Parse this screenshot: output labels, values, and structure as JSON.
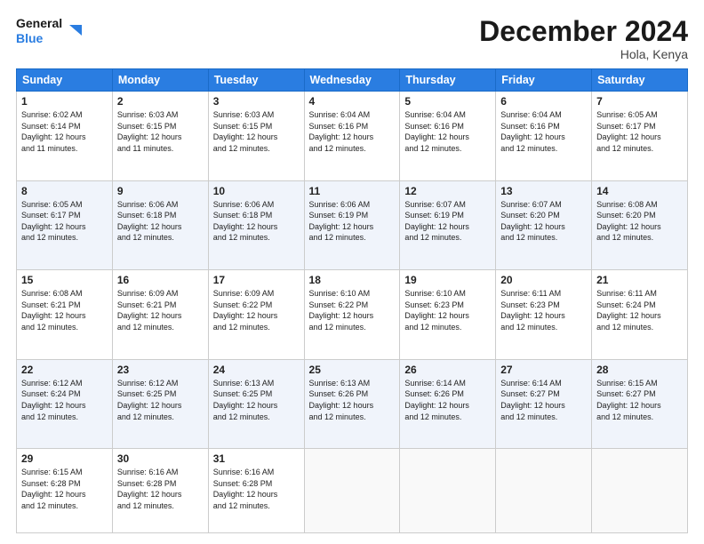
{
  "logo": {
    "line1": "General",
    "line2": "Blue"
  },
  "title": "December 2024",
  "location": "Hola, Kenya",
  "days_header": [
    "Sunday",
    "Monday",
    "Tuesday",
    "Wednesday",
    "Thursday",
    "Friday",
    "Saturday"
  ],
  "weeks": [
    [
      {
        "num": "1",
        "sunrise": "6:02 AM",
        "sunset": "6:14 PM",
        "daylight": "12 hours and 11 minutes."
      },
      {
        "num": "2",
        "sunrise": "6:03 AM",
        "sunset": "6:15 PM",
        "daylight": "12 hours and 11 minutes."
      },
      {
        "num": "3",
        "sunrise": "6:03 AM",
        "sunset": "6:15 PM",
        "daylight": "12 hours and 12 minutes."
      },
      {
        "num": "4",
        "sunrise": "6:04 AM",
        "sunset": "6:16 PM",
        "daylight": "12 hours and 12 minutes."
      },
      {
        "num": "5",
        "sunrise": "6:04 AM",
        "sunset": "6:16 PM",
        "daylight": "12 hours and 12 minutes."
      },
      {
        "num": "6",
        "sunrise": "6:04 AM",
        "sunset": "6:16 PM",
        "daylight": "12 hours and 12 minutes."
      },
      {
        "num": "7",
        "sunrise": "6:05 AM",
        "sunset": "6:17 PM",
        "daylight": "12 hours and 12 minutes."
      }
    ],
    [
      {
        "num": "8",
        "sunrise": "6:05 AM",
        "sunset": "6:17 PM",
        "daylight": "12 hours and 12 minutes."
      },
      {
        "num": "9",
        "sunrise": "6:06 AM",
        "sunset": "6:18 PM",
        "daylight": "12 hours and 12 minutes."
      },
      {
        "num": "10",
        "sunrise": "6:06 AM",
        "sunset": "6:18 PM",
        "daylight": "12 hours and 12 minutes."
      },
      {
        "num": "11",
        "sunrise": "6:06 AM",
        "sunset": "6:19 PM",
        "daylight": "12 hours and 12 minutes."
      },
      {
        "num": "12",
        "sunrise": "6:07 AM",
        "sunset": "6:19 PM",
        "daylight": "12 hours and 12 minutes."
      },
      {
        "num": "13",
        "sunrise": "6:07 AM",
        "sunset": "6:20 PM",
        "daylight": "12 hours and 12 minutes."
      },
      {
        "num": "14",
        "sunrise": "6:08 AM",
        "sunset": "6:20 PM",
        "daylight": "12 hours and 12 minutes."
      }
    ],
    [
      {
        "num": "15",
        "sunrise": "6:08 AM",
        "sunset": "6:21 PM",
        "daylight": "12 hours and 12 minutes."
      },
      {
        "num": "16",
        "sunrise": "6:09 AM",
        "sunset": "6:21 PM",
        "daylight": "12 hours and 12 minutes."
      },
      {
        "num": "17",
        "sunrise": "6:09 AM",
        "sunset": "6:22 PM",
        "daylight": "12 hours and 12 minutes."
      },
      {
        "num": "18",
        "sunrise": "6:10 AM",
        "sunset": "6:22 PM",
        "daylight": "12 hours and 12 minutes."
      },
      {
        "num": "19",
        "sunrise": "6:10 AM",
        "sunset": "6:23 PM",
        "daylight": "12 hours and 12 minutes."
      },
      {
        "num": "20",
        "sunrise": "6:11 AM",
        "sunset": "6:23 PM",
        "daylight": "12 hours and 12 minutes."
      },
      {
        "num": "21",
        "sunrise": "6:11 AM",
        "sunset": "6:24 PM",
        "daylight": "12 hours and 12 minutes."
      }
    ],
    [
      {
        "num": "22",
        "sunrise": "6:12 AM",
        "sunset": "6:24 PM",
        "daylight": "12 hours and 12 minutes."
      },
      {
        "num": "23",
        "sunrise": "6:12 AM",
        "sunset": "6:25 PM",
        "daylight": "12 hours and 12 minutes."
      },
      {
        "num": "24",
        "sunrise": "6:13 AM",
        "sunset": "6:25 PM",
        "daylight": "12 hours and 12 minutes."
      },
      {
        "num": "25",
        "sunrise": "6:13 AM",
        "sunset": "6:26 PM",
        "daylight": "12 hours and 12 minutes."
      },
      {
        "num": "26",
        "sunrise": "6:14 AM",
        "sunset": "6:26 PM",
        "daylight": "12 hours and 12 minutes."
      },
      {
        "num": "27",
        "sunrise": "6:14 AM",
        "sunset": "6:27 PM",
        "daylight": "12 hours and 12 minutes."
      },
      {
        "num": "28",
        "sunrise": "6:15 AM",
        "sunset": "6:27 PM",
        "daylight": "12 hours and 12 minutes."
      }
    ],
    [
      {
        "num": "29",
        "sunrise": "6:15 AM",
        "sunset": "6:28 PM",
        "daylight": "12 hours and 12 minutes."
      },
      {
        "num": "30",
        "sunrise": "6:16 AM",
        "sunset": "6:28 PM",
        "daylight": "12 hours and 12 minutes."
      },
      {
        "num": "31",
        "sunrise": "6:16 AM",
        "sunset": "6:28 PM",
        "daylight": "12 hours and 12 minutes."
      },
      null,
      null,
      null,
      null
    ]
  ],
  "labels": {
    "sunrise": "Sunrise:",
    "sunset": "Sunset:",
    "daylight": "Daylight:"
  }
}
